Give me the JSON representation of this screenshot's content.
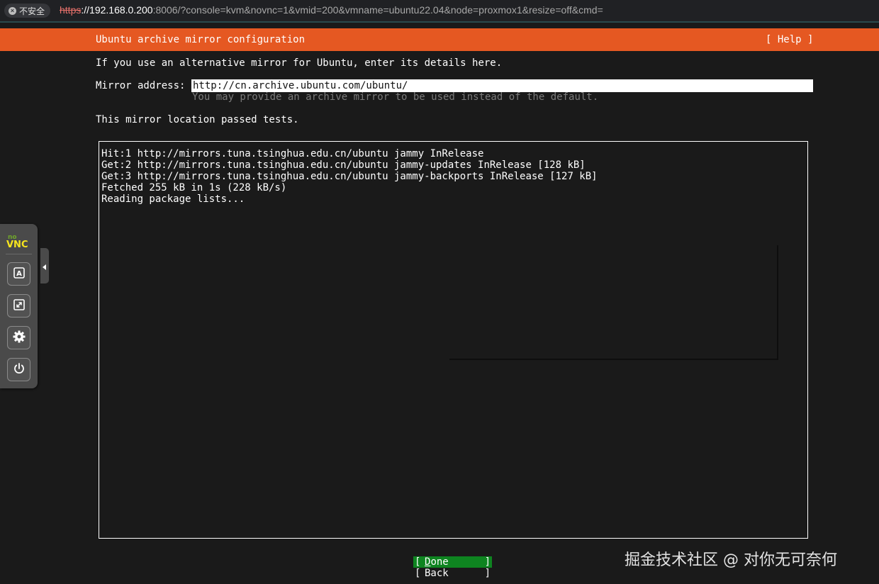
{
  "browser": {
    "security_badge": "不安全",
    "url_scheme": "https",
    "url_host": "://192.168.0.200",
    "url_rest": ":8006/?console=kvm&novnc=1&vmid=200&vmname=ubuntu22.04&node=proxmox1&resize=off&cmd="
  },
  "installer": {
    "title": "Ubuntu archive mirror configuration",
    "help": "[ Help ]",
    "intro": "If you use an alternative mirror for Ubuntu, enter its details here.",
    "mirror_label": "Mirror address:",
    "mirror_value": "http://cn.archive.ubuntu.com/ubuntu/",
    "mirror_help": "You may provide an archive mirror to be used instead of the default.",
    "status": "This mirror location passed tests.",
    "log_lines": [
      "Hit:1 http://mirrors.tuna.tsinghua.edu.cn/ubuntu jammy InRelease",
      "Get:2 http://mirrors.tuna.tsinghua.edu.cn/ubuntu jammy-updates InRelease [128 kB]",
      "Get:3 http://mirrors.tuna.tsinghua.edu.cn/ubuntu jammy-backports InRelease [127 kB]",
      "Fetched 255 kB in 1s (228 kB/s)",
      "Reading package lists..."
    ],
    "done_button": {
      "open": "[",
      "hotkey": "D",
      "rest": "one",
      "close": "]"
    },
    "back_button": {
      "open": "[",
      "label": "Back",
      "close": "]"
    }
  },
  "novnc": {
    "logo_top": "no",
    "logo_bottom": "VNC",
    "buttons": [
      "keyboard-icon",
      "fullscreen-icon",
      "settings-icon",
      "power-icon"
    ]
  },
  "watermark": "掘金技术社区 @ 对你无可奈何",
  "colors": {
    "title_bar": "#e55822",
    "done_button": "#0e8420",
    "background": "#1a1a1a"
  }
}
